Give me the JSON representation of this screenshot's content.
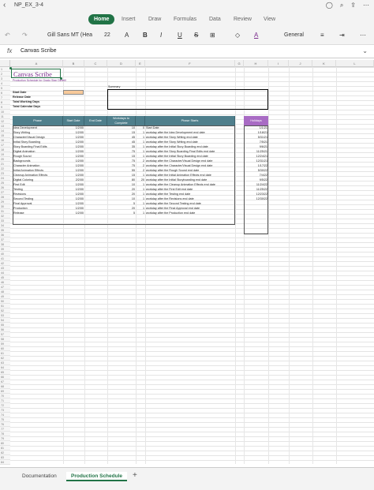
{
  "window": {
    "title": "NP_EX_3-4"
  },
  "tabs": [
    "Home",
    "Insert",
    "Draw",
    "Formulas",
    "Data",
    "Review",
    "View"
  ],
  "ribbon": {
    "font": "Gill Sans MT (Hea",
    "size": "22",
    "bold": "B",
    "italic": "I",
    "underline": "U",
    "strike": "S",
    "number_format": "General"
  },
  "formula_bar": {
    "fx": "fx",
    "value": "Canvas Scribe"
  },
  "columns": [
    "A",
    "B",
    "C",
    "D",
    "E",
    "F",
    "G",
    "H",
    "I",
    "J",
    "K",
    "L"
  ],
  "sheet": {
    "title": "Canvas Scribe",
    "subtitle": "Production Schedule for Grado Stan Dimbill",
    "summary_label": "Summary",
    "info_labels": [
      "Start Date",
      "Release Date",
      "Total Working Days",
      "Total Calendar Days"
    ],
    "headers": [
      "Phase",
      "Start Date",
      "End Date",
      "Workdays to Complete",
      "",
      "Phase Starts"
    ],
    "holidays_header": "Holidays",
    "tasks": [
      [
        "Idea Development",
        "1/2/00",
        "",
        "10",
        "0",
        "Start Date"
      ],
      [
        "Story Writing",
        "1/2/00",
        "",
        "15",
        "1",
        "workday after the Idea Development end date"
      ],
      [
        "Character/Visual Design",
        "1/2/00",
        "",
        "45",
        "1",
        "workday after the Story Writing end date"
      ],
      [
        "Initial Story Boarding",
        "1/2/00",
        "",
        "45",
        "1",
        "workday after the Story Writing end date"
      ],
      [
        "Story Boarding Final Edits",
        "1/2/00",
        "",
        "35",
        "1",
        "workday after the Initial Story Boarding end date"
      ],
      [
        "Digital Animation",
        "1/2/00",
        "",
        "75",
        "1",
        "workday after the Story Boarding Final Edits end date"
      ],
      [
        "Rough Sound",
        "1/2/00",
        "",
        "15",
        "1",
        "workday after the Initial Story Boarding end date"
      ],
      [
        "Backgrounds",
        "1/2/00",
        "",
        "75",
        "2",
        "workday after the Character/Visual Design end date"
      ],
      [
        "Character Animation",
        "1/2/00",
        "",
        "75",
        "2",
        "workday after the Character/Visual Design end date"
      ],
      [
        "Initial Animation Effects",
        "1/2/00",
        "",
        "55",
        "2",
        "workday after the Rough Sound end date"
      ],
      [
        "Cleanup Animation Effects",
        "1/2/00",
        "",
        "15",
        "1",
        "workday after the Initial Animation Effects end date"
      ],
      [
        "Digital Coloring",
        "2/2/00",
        "",
        "80",
        "20",
        "workday after the Initial Storyboarding end date"
      ],
      [
        "First Edit",
        "1/2/00",
        "",
        "10",
        "1",
        "workday after the Cleanup Animation Effects end date"
      ],
      [
        "Testing",
        "1/2/00",
        "",
        "20",
        "1",
        "workday after the First Edit end date"
      ],
      [
        "Revisions",
        "1/2/00",
        "",
        "20",
        "1",
        "workday after the Testing end date"
      ],
      [
        "Second Testing",
        "1/2/00",
        "",
        "10",
        "1",
        "workday after the Revisions end date"
      ],
      [
        "Final Approval",
        "1/2/00",
        "",
        "5",
        "1",
        "workday after the Second Testing end date"
      ],
      [
        "Production",
        "1/2/00",
        "",
        "20",
        "1",
        "workday after the Final Approval end date"
      ],
      [
        "Release",
        "1/2/00",
        "",
        "5",
        "1",
        "workday after the Production end date"
      ]
    ],
    "holidays": [
      "1/1/21",
      "1/18/21",
      "5/31/21",
      "7/5/21",
      "9/6/21",
      "11/25/21",
      "12/24/21",
      "12/31/21",
      "1/17/22",
      "5/30/22",
      "7/4/22",
      "9/5/22",
      "11/24/22",
      "11/25/22",
      "12/23/22",
      "12/30/22"
    ]
  },
  "sheet_tabs": [
    "Documentation",
    "Production Schedule"
  ],
  "add_sheet": "+"
}
